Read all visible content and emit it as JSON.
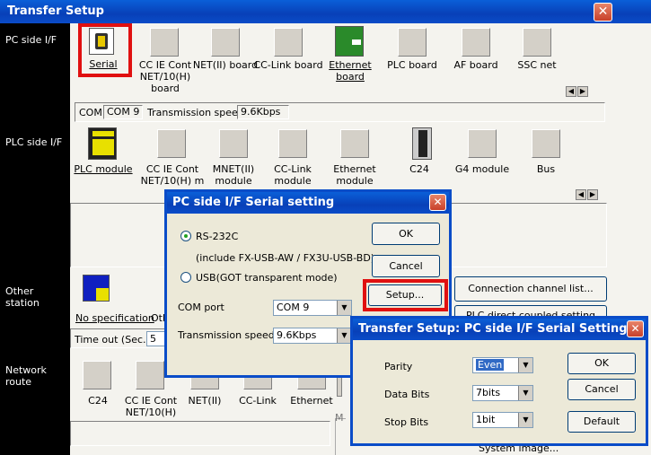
{
  "window": {
    "title": "Transfer Setup"
  },
  "sidebar": {
    "pc_side": "PC side I/F",
    "plc_side": "PLC side I/F",
    "other_station": "Other station",
    "network_route": "Network route"
  },
  "pc_side_icons": [
    {
      "label": "Serial"
    },
    {
      "label": "CC IE Cont NET/10(H) board"
    },
    {
      "label": "NET(II) board"
    },
    {
      "label": "CC-Link board"
    },
    {
      "label": "Ethernet board"
    },
    {
      "label": "PLC board"
    },
    {
      "label": "AF board"
    },
    {
      "label": "SSC net"
    }
  ],
  "com_info": {
    "com_label": "COM",
    "com_value": "COM 9",
    "speed_label": "Transmission speed",
    "speed_value": "9.6Kbps"
  },
  "plc_side_icons": [
    {
      "label": "PLC module"
    },
    {
      "label": "CC IE Cont NET/10(H) m"
    },
    {
      "label": "MNET(II) module"
    },
    {
      "label": "CC-Link module"
    },
    {
      "label": "Ethernet module"
    },
    {
      "label": "C24"
    },
    {
      "label": "G4 module"
    },
    {
      "label": "Bus"
    }
  ],
  "other_station": {
    "no_spec": "No specification",
    "oth": "Oth",
    "timeout_label": "Time out (Sec.)",
    "timeout_value": "5",
    "conn_channel_button": "Connection channel list...",
    "plc_direct_button": "PLC direct coupled setting"
  },
  "network_icons": [
    {
      "label": "C24"
    },
    {
      "label": "CC IE Cont NET/10(H)"
    },
    {
      "label": "NET(II)"
    },
    {
      "label": "CC-Link"
    },
    {
      "label": "Ethernet"
    }
  ],
  "bottom": {
    "m_label": "M",
    "system_image": "System  image..."
  },
  "serial_dialog": {
    "title": "PC side I/F  Serial setting",
    "rs232c": "RS-232C",
    "include_note": "(include FX-USB-AW / FX3U-USB-BD)",
    "usb": "USB(GOT transparent mode)",
    "com_port_label": "COM port",
    "com_port_value": "COM 9",
    "speed_label": "Transmission speed",
    "speed_value": "9.6Kbps",
    "ok": "OK",
    "cancel": "Cancel",
    "setup": "Setup..."
  },
  "serial_setting_dialog": {
    "title": "Transfer Setup: PC side I/F Serial Setting",
    "parity_label": "Parity",
    "parity_value": "Even",
    "data_bits_label": "Data Bits",
    "data_bits_value": "7bits",
    "stop_bits_label": "Stop Bits",
    "stop_bits_value": "1bit",
    "ok": "OK",
    "cancel": "Cancel",
    "default": "Default"
  },
  "colors": {
    "title_blue": "#0a4cc8",
    "highlight_red": "#e01010",
    "sidebar_black": "#000000"
  }
}
